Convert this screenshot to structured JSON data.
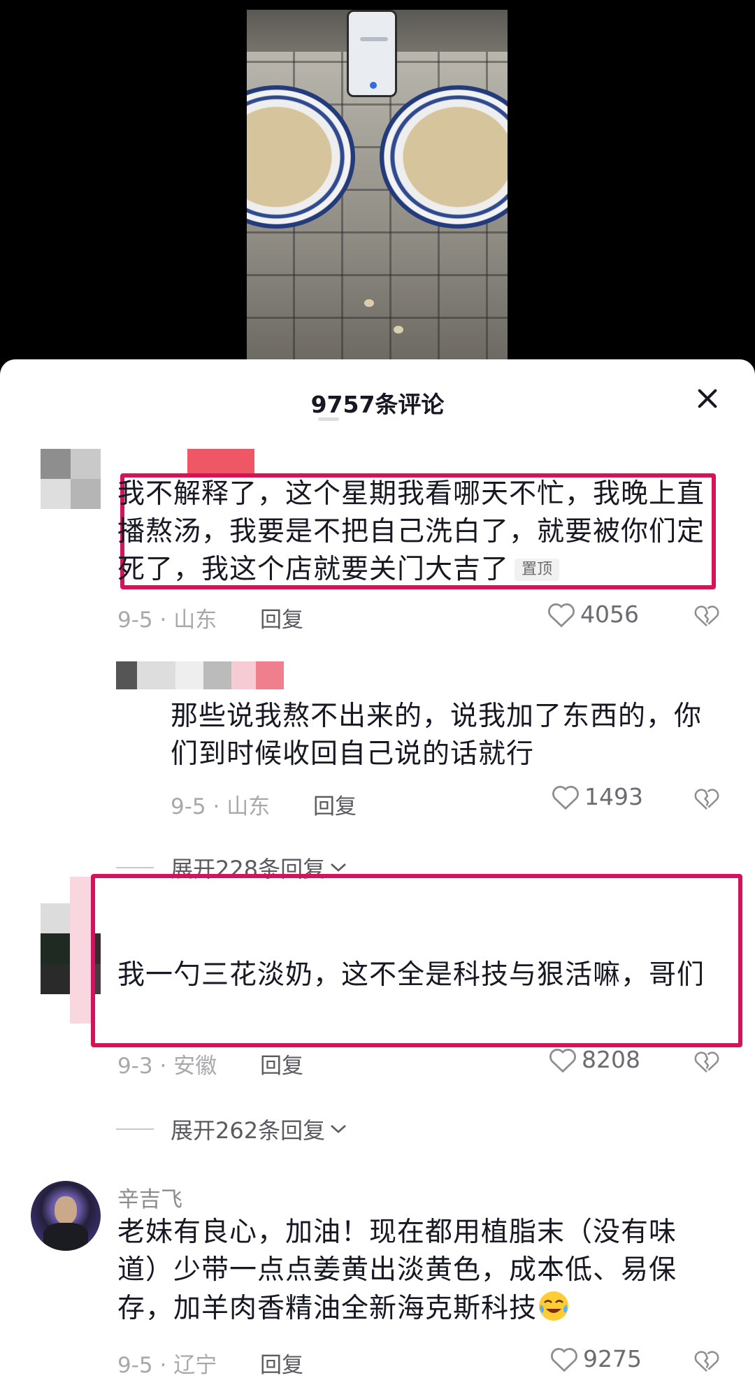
{
  "panel": {
    "title": "9757条评论"
  },
  "comments": [
    {
      "username": "",
      "text": "我不解释了，这个星期我看哪天不忙，我晚上直播熬汤，我要是不把自己洗白了，就要被你们定死了，我这个店就要关门大吉了",
      "pinned_label": "置顶",
      "meta": "9-5 · 山东",
      "reply_label": "回复",
      "likes": "4056"
    },
    {
      "username": "",
      "text": "那些说我熬不出来的，说我加了东西的，你们到时候收回自己说的话就行",
      "meta": "9-5 · 山东",
      "reply_label": "回复",
      "likes": "1493"
    },
    {
      "expand_label": "展开228条回复"
    },
    {
      "username": "",
      "text": "我一勺三花淡奶，这不全是科技与狠活嘛，哥们",
      "meta": "9-3 · 安徽",
      "reply_label": "回复",
      "likes": "8208"
    },
    {
      "expand_label": "展开262条回复"
    },
    {
      "username": "辛吉飞",
      "text": "老妹有良心，加油！现在都用植脂末（没有味道）少带一点点姜黄出淡黄色，成本低、易保存，加羊肉香精油全新海克斯科技",
      "meta": "9-5 · 辽宁",
      "reply_label": "回复",
      "likes": "9275"
    }
  ],
  "colors": {
    "highlight": "#d4145a",
    "text": "#161823",
    "meta": "#a8a8ad"
  }
}
